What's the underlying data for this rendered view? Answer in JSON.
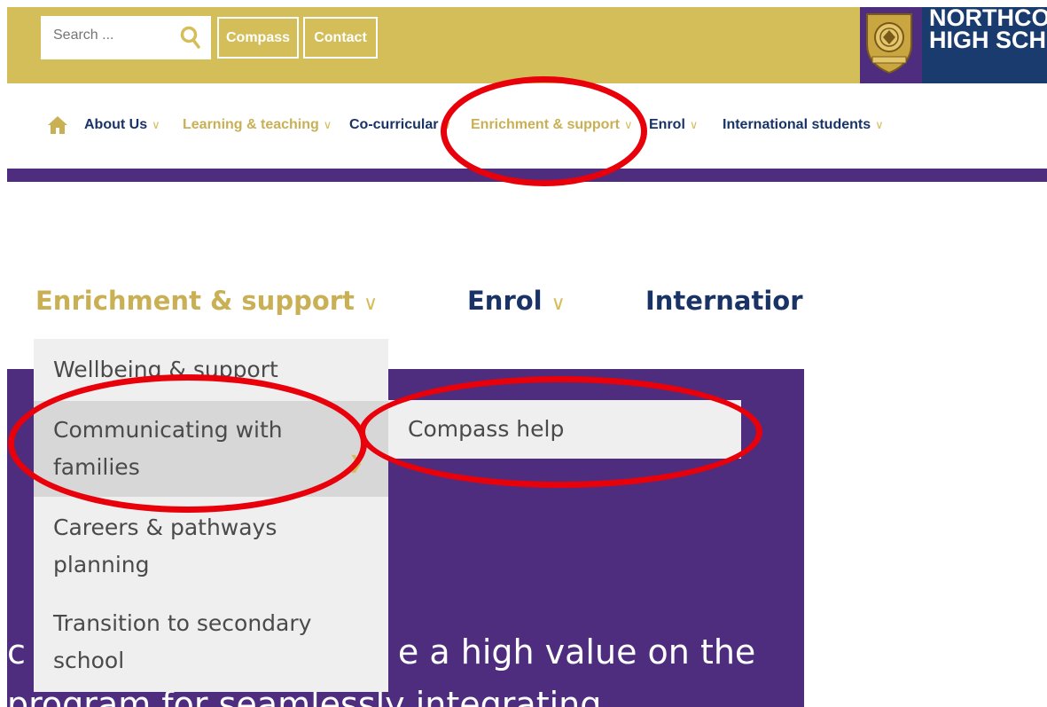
{
  "header": {
    "search_placeholder": "Search ...",
    "compass_label": "Compass",
    "contact_label": "Contact",
    "school_name_line1": "NORTHCO",
    "school_name_line2": "HIGH SCHO"
  },
  "nav": {
    "items": [
      {
        "label": "About Us",
        "chevron": "∨"
      },
      {
        "label": "Learning & teaching",
        "chevron": "∨"
      },
      {
        "label": "Co-curricular",
        "chevron": "∨"
      },
      {
        "label": "Enrichment & support",
        "chevron": "∨"
      },
      {
        "label": "Enrol",
        "chevron": "∨"
      },
      {
        "label": "International students",
        "chevron": "∨"
      }
    ]
  },
  "zoomed": {
    "nav_items": [
      {
        "label": "Enrichment & support",
        "chevron": "∨"
      },
      {
        "label": "Enrol",
        "chevron": "∨"
      },
      {
        "label": "Internatior"
      }
    ],
    "dropdown": [
      {
        "line1": "Wellbeing & support"
      },
      {
        "line1": "Communicating with",
        "line2": "families"
      },
      {
        "line1": "Careers & pathways",
        "line2": "planning"
      },
      {
        "line1": "Transition to secondary",
        "line2": "school"
      }
    ],
    "submenu_item": "Compass help",
    "hero_line1_prefix": "c",
    "hero_line1_suffix": "e a high value on the",
    "hero_line2": "program for seamlessly integrating"
  },
  "colors": {
    "gold": "#d4be5a",
    "purple": "#4e2d7e",
    "navy": "#1a3b6d",
    "annotation_red": "#e8000b"
  },
  "icons": [
    "search-icon",
    "home-icon",
    "school-crest-icon",
    "chevron-down-icon"
  ]
}
